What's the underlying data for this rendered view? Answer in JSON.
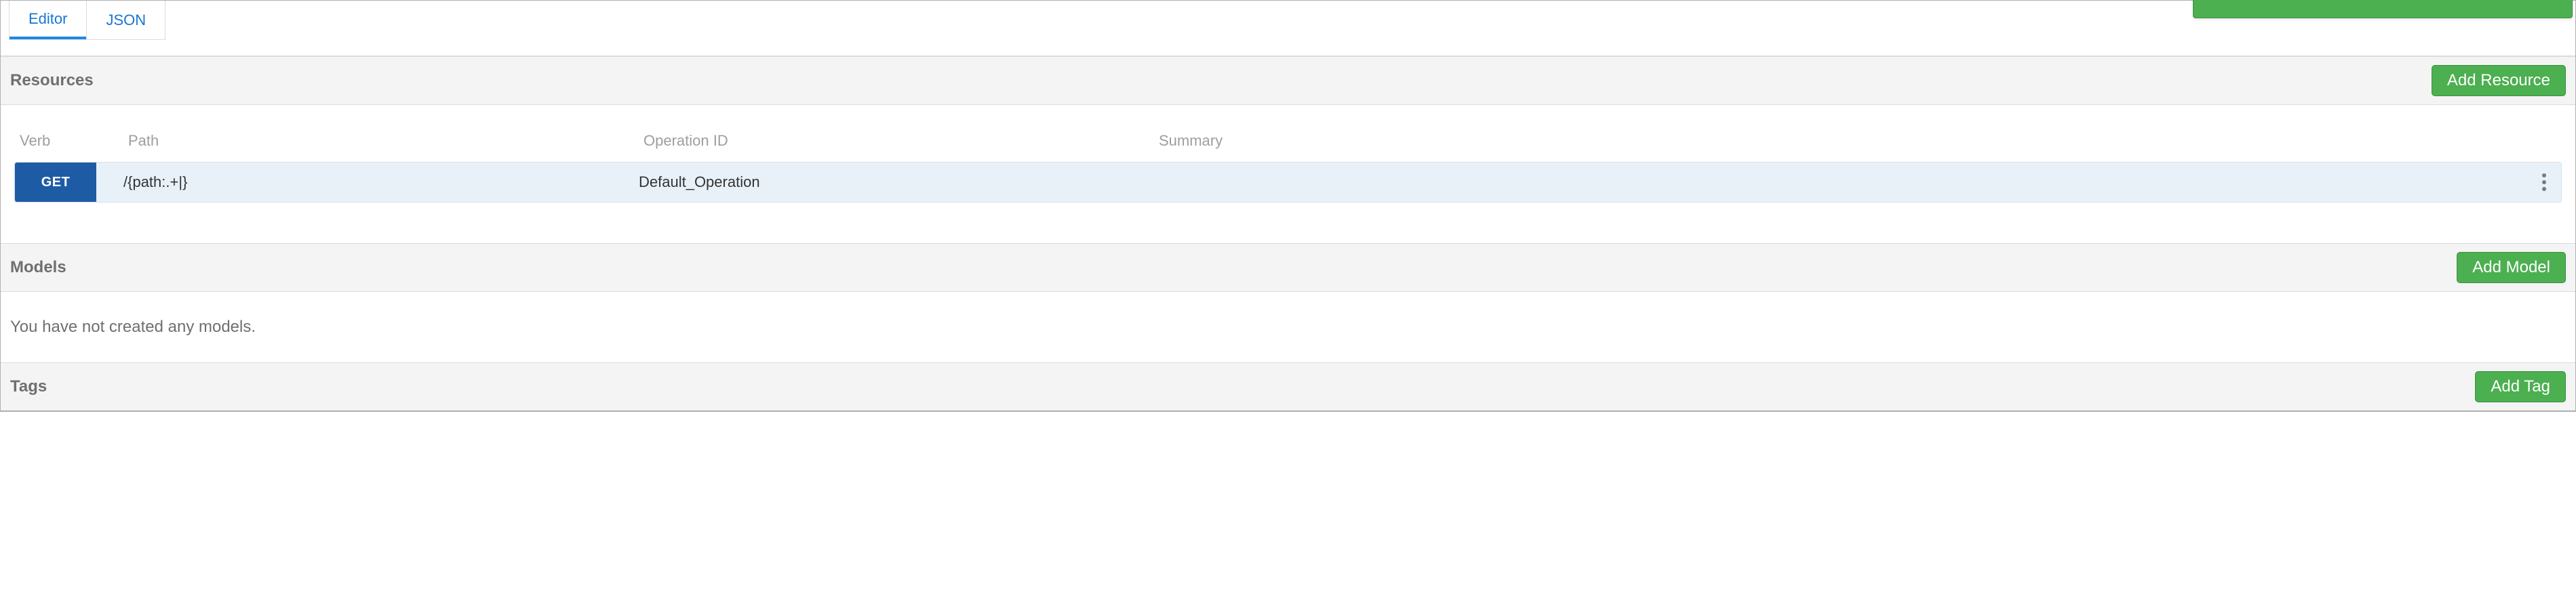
{
  "tabs": {
    "editor": "Editor",
    "json": "JSON"
  },
  "resources": {
    "title": "Resources",
    "add_btn": "Add Resource",
    "columns": {
      "verb": "Verb",
      "path": "Path",
      "opid": "Operation ID",
      "summary": "Summary"
    },
    "rows": [
      {
        "verb": "GET",
        "path": "/{path:.+|}",
        "op_id": "Default_Operation",
        "summary": ""
      }
    ]
  },
  "models": {
    "title": "Models",
    "add_btn": "Add Model",
    "empty_msg": "You have not created any models."
  },
  "tags": {
    "title": "Tags",
    "add_btn": "Add Tag"
  }
}
